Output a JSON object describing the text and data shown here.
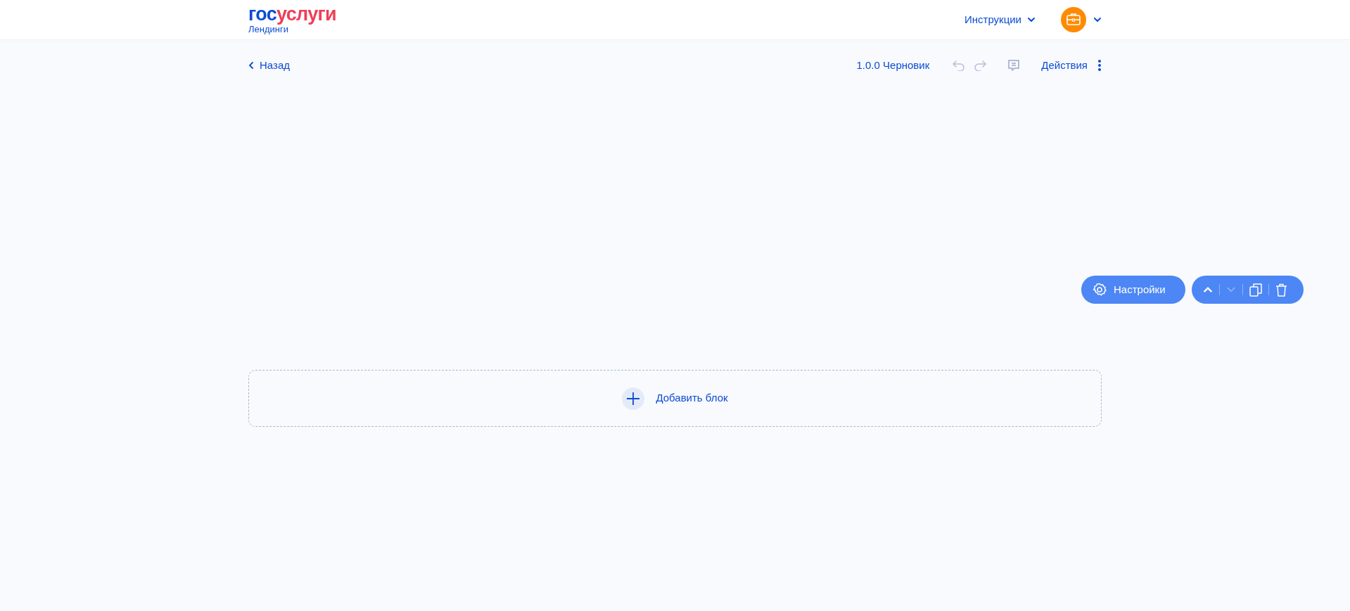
{
  "header": {
    "logo": {
      "part_1": "гос",
      "part_2": "услуги",
      "subtitle": "Лендинги"
    },
    "instructions": "Инструкции"
  },
  "toolbar": {
    "back": "Назад",
    "version": "1.0.0 Черновик",
    "undo": {
      "disabled": true
    },
    "redo": {
      "disabled": true
    },
    "actions": "Действия"
  },
  "block_controls": {
    "settings": "Настройки",
    "move_up": {
      "disabled": false
    },
    "move_down": {
      "disabled": true
    }
  },
  "add_block": "Добавить блок"
}
